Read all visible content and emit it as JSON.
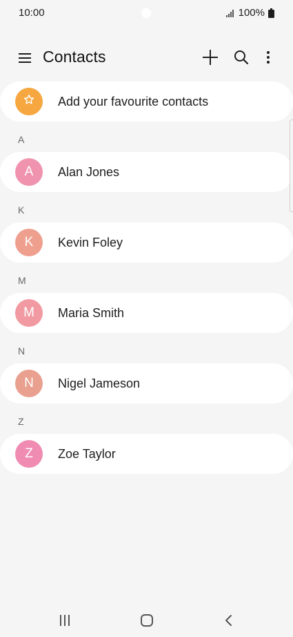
{
  "status_bar": {
    "time": "10:00",
    "battery": "100%",
    "icons": [
      "signal-icon",
      "battery-icon"
    ]
  },
  "app_bar": {
    "title": "Contacts",
    "icons": [
      "menu-icon",
      "add-icon",
      "search-icon",
      "more-options-icon"
    ]
  },
  "favourites": {
    "label": "Add your favourite contacts",
    "icon": "star-icon",
    "color": "#f6a740"
  },
  "sections": [
    {
      "header": "A",
      "contacts": [
        {
          "initial": "A",
          "name": "Alan Jones",
          "color": "#f093ae"
        }
      ]
    },
    {
      "header": "K",
      "contacts": [
        {
          "initial": "K",
          "name": "Kevin Foley",
          "color": "#ee9f8e"
        }
      ]
    },
    {
      "header": "M",
      "contacts": [
        {
          "initial": "M",
          "name": "Maria Smith",
          "color": "#f19aa2"
        }
      ]
    },
    {
      "header": "N",
      "contacts": [
        {
          "initial": "N",
          "name": "Nigel Jameson",
          "color": "#e9a08f"
        }
      ]
    },
    {
      "header": "Z",
      "contacts": [
        {
          "initial": "Z",
          "name": "Zoe Taylor",
          "color": "#f08bb2"
        }
      ]
    }
  ],
  "nav_bar": {
    "icons": [
      "recent-apps-icon",
      "home-icon",
      "back-icon"
    ]
  },
  "colors": {
    "background": "#f5f5f5",
    "card": "#ffffff"
  }
}
